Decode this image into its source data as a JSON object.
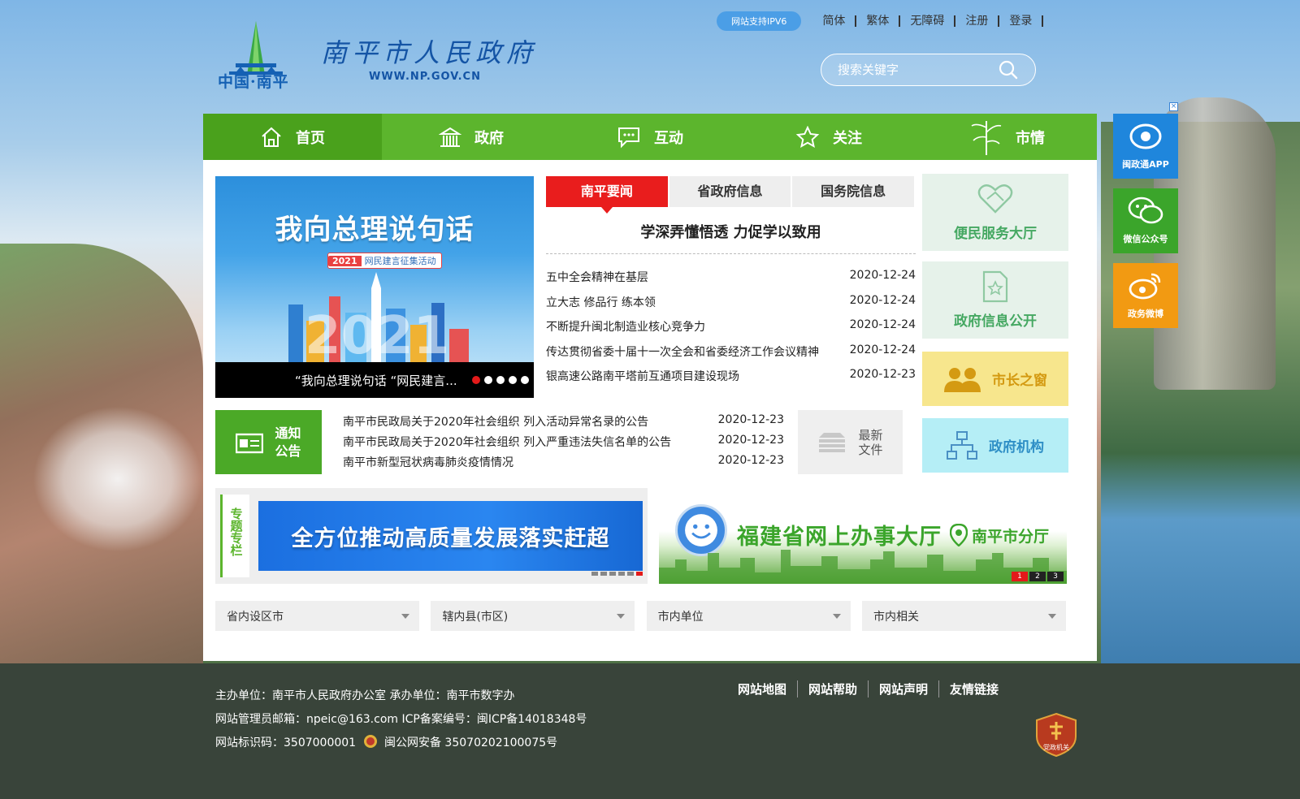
{
  "header": {
    "logo_cn": "中国·南平",
    "site_title": "南平市人民政府",
    "site_url": "WWW.NP.GOV.CN",
    "ipv6": "网站支持IPV6",
    "top_links": [
      "简体",
      "繁体",
      "无障碍",
      "注册",
      "登录"
    ],
    "search_placeholder": "搜索关键字"
  },
  "nav": [
    {
      "label": "首页",
      "icon": "home-icon"
    },
    {
      "label": "政府",
      "icon": "building-icon"
    },
    {
      "label": "互动",
      "icon": "chat-icon"
    },
    {
      "label": "关注",
      "icon": "star-icon"
    },
    {
      "label": "市情",
      "icon": "bamboo-icon"
    }
  ],
  "slider": {
    "title": "我向总理说句话",
    "tag_year": "2021",
    "tag_text": "网民建言征集活动",
    "caption": "“我向总理说句话 “网民建言...",
    "dot_count": 5,
    "active_dot": 0
  },
  "news": {
    "tabs": [
      "南平要闻",
      "省政府信息",
      "国务院信息"
    ],
    "headline": "学深弄懂悟透 力促学以致用",
    "items": [
      {
        "title": "五中全会精神在基层",
        "date": "2020-12-24"
      },
      {
        "title": "立大志 修品行 练本领",
        "date": "2020-12-24"
      },
      {
        "title": "不断提升闽北制造业核心竞争力",
        "date": "2020-12-24"
      },
      {
        "title": "传达贯彻省委十届十一次全会和省委经济工作会议精神",
        "date": "2020-12-24"
      },
      {
        "title": "银高速公路南平塔前互通项目建设现场",
        "date": "2020-12-23"
      }
    ]
  },
  "notice": {
    "label_line1": "通知",
    "label_line2": "公告",
    "items": [
      {
        "title": "南平市民政局关于2020年社会组织 列入活动异常名录的公告",
        "date": "2020-12-23"
      },
      {
        "title": "南平市民政局关于2020年社会组织 列入严重违法失信名单的公告",
        "date": "2020-12-23"
      },
      {
        "title": "南平市新型冠状病毒肺炎疫情情况",
        "date": "2020-12-23"
      }
    ],
    "latest_line1": "最新",
    "latest_line2": "文件"
  },
  "services": [
    {
      "label": "便民服务大厅",
      "icon": "handshake-icon",
      "color": "#45a862"
    },
    {
      "label": "政府信息公开",
      "icon": "document-star-icon",
      "color": "#45a862"
    },
    {
      "label": "市长之窗",
      "icon": "people-icon",
      "color": "#d49a12"
    },
    {
      "label": "政府机构",
      "icon": "org-chart-icon",
      "color": "#2f8fc6"
    }
  ],
  "topic": {
    "side_label": "专题专栏",
    "banner_text": "全方位推动高质量发展落实赶超",
    "dot_count": 6,
    "active_dot": 5
  },
  "fj_banner": {
    "title": "福建省网上办事大厅",
    "sub": "南平市分厅",
    "pages": [
      "1",
      "2",
      "3"
    ],
    "active_page": 0
  },
  "selects": [
    "省内设区市",
    "辖内县(市区)",
    "市内单位",
    "市内相关"
  ],
  "floats": [
    {
      "label": "闽政通APP",
      "icon": "app-icon",
      "color": "#1f86dc"
    },
    {
      "label": "微信公众号",
      "icon": "wechat-icon",
      "color": "#3ba52b"
    },
    {
      "label": "政务微博",
      "icon": "weibo-icon",
      "color": "#f29a12"
    }
  ],
  "float_close": "×",
  "footer": {
    "line1": "主办单位：南平市人民政府办公室 承办单位：南平市数字办",
    "line2": "网站管理员邮箱：npeic@163.com ICP备案编号：闽ICP备14018348号",
    "line3a": "网站标识码：3507000001",
    "line3b": "闽公网安备 35070202100075号",
    "links": [
      "网站地图",
      "网站帮助",
      "网站声明",
      "友情链接"
    ],
    "badge_text": "党政机关"
  },
  "colors": {
    "nav_green": "#5cb52d",
    "news_red": "#e91d1d",
    "footer_bg": "#39443a"
  }
}
